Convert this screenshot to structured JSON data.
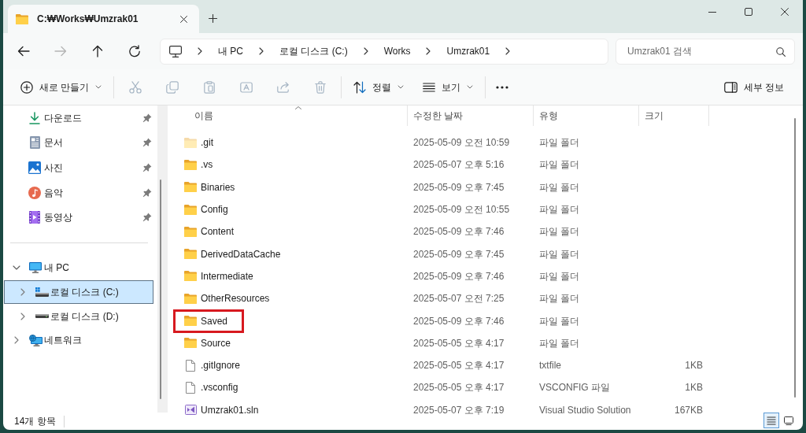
{
  "tab": {
    "title": "C:₩Works₩Umzrak01"
  },
  "nav_buttons": [
    {
      "kind": "back",
      "disabled": false
    },
    {
      "kind": "forward",
      "disabled": true
    },
    {
      "kind": "up",
      "disabled": false
    },
    {
      "kind": "refresh",
      "disabled": false
    }
  ],
  "address_bar": {
    "crumbs": [
      "내 PC",
      "로컬 디스크 (C:)",
      "Works",
      "Umzrak01"
    ]
  },
  "search": {
    "placeholder": "Umzrak01 검색"
  },
  "toolbar": {
    "groups": [
      [
        {
          "kind": "new",
          "label": "새로 만들기",
          "dropdown": true,
          "disabled": false
        }
      ],
      [
        {
          "kind": "cut",
          "disabled": true
        },
        {
          "kind": "copy",
          "disabled": true
        },
        {
          "kind": "paste",
          "disabled": true
        },
        {
          "kind": "rename",
          "disabled": true
        },
        {
          "kind": "share",
          "disabled": true
        },
        {
          "kind": "delete",
          "disabled": true
        }
      ],
      [
        {
          "kind": "sort",
          "label": "정렬",
          "dropdown": true,
          "disabled": false
        },
        {
          "kind": "view",
          "label": "보기",
          "dropdown": true,
          "disabled": false
        }
      ],
      [
        {
          "kind": "more",
          "disabled": false
        }
      ]
    ],
    "details_button": {
      "kind": "details",
      "label": "세부 정보",
      "dropdown": false,
      "disabled": false
    }
  },
  "sidebar": {
    "quick_access": [
      {
        "kind": "downloads",
        "label": "다운로드",
        "pinned": true
      },
      {
        "kind": "documents",
        "label": "문서",
        "pinned": true
      },
      {
        "kind": "pictures",
        "label": "사진",
        "pinned": true
      },
      {
        "kind": "music",
        "label": "음악",
        "pinned": true
      },
      {
        "kind": "videos",
        "label": "동영상",
        "pinned": true
      }
    ],
    "tree": [
      {
        "kind": "pc",
        "label": "내 PC",
        "expanded": true,
        "selected": false,
        "children": [
          {
            "kind": "windows-drive",
            "label": "로컬 디스크 (C:)",
            "expanded": false,
            "selected": true
          },
          {
            "kind": "drive",
            "label": "로컬 디스크 (D:)",
            "expanded": false,
            "selected": false
          }
        ]
      },
      {
        "kind": "network",
        "label": "네트워크",
        "expanded": false,
        "selected": false
      }
    ]
  },
  "file_list": {
    "columns": [
      {
        "label": "이름",
        "sorted": true
      },
      {
        "label": "수정한 날짜",
        "sorted": false
      },
      {
        "label": "유형",
        "sorted": false
      },
      {
        "label": "크기",
        "sorted": false
      }
    ],
    "rows": [
      {
        "kind": "folder",
        "name": ".git",
        "modified": "2025-05-09 오전 10:59",
        "type": "파일 폴더",
        "hidden": true,
        "highlighted": false
      },
      {
        "kind": "folder",
        "name": ".vs",
        "modified": "2025-05-07 오후 5:16",
        "type": "파일 폴더",
        "hidden": false,
        "highlighted": false
      },
      {
        "kind": "folder",
        "name": "Binaries",
        "modified": "2025-05-09 오후 7:45",
        "type": "파일 폴더",
        "hidden": false,
        "highlighted": false
      },
      {
        "kind": "folder",
        "name": "Config",
        "modified": "2025-05-09 오전 10:55",
        "type": "파일 폴더",
        "hidden": false,
        "highlighted": false
      },
      {
        "kind": "folder",
        "name": "Content",
        "modified": "2025-05-09 오후 7:46",
        "type": "파일 폴더",
        "hidden": false,
        "highlighted": false
      },
      {
        "kind": "folder",
        "name": "DerivedDataCache",
        "modified": "2025-05-09 오후 7:45",
        "type": "파일 폴더",
        "hidden": false,
        "highlighted": false
      },
      {
        "kind": "folder",
        "name": "Intermediate",
        "modified": "2025-05-09 오후 7:46",
        "type": "파일 폴더",
        "hidden": false,
        "highlighted": false
      },
      {
        "kind": "folder",
        "name": "OtherResources",
        "modified": "2025-05-07 오전 7:25",
        "type": "파일 폴더",
        "hidden": false,
        "highlighted": false
      },
      {
        "kind": "folder",
        "name": "Saved",
        "modified": "2025-05-09 오후 7:46",
        "type": "파일 폴더",
        "hidden": false,
        "highlighted": true
      },
      {
        "kind": "folder",
        "name": "Source",
        "modified": "2025-05-05 오후 4:17",
        "type": "파일 폴더",
        "hidden": false,
        "highlighted": false
      },
      {
        "kind": "file",
        "name": ".gitIgnore",
        "modified": "2025-05-05 오후 4:17",
        "type": "txtfile",
        "size": "1KB",
        "hidden": false,
        "highlighted": false
      },
      {
        "kind": "file",
        "name": ".vsconfig",
        "modified": "2025-05-05 오후 4:17",
        "type": "VSCONFIG 파일",
        "size": "1KB",
        "hidden": false,
        "highlighted": false
      },
      {
        "kind": "solution",
        "name": "Umzrak01.sln",
        "modified": "2025-05-07 오후 7:19",
        "type": "Visual Studio Solution",
        "size": "167KB",
        "hidden": false,
        "highlighted": false
      }
    ]
  },
  "status_bar": {
    "item_count": "14개 항목"
  },
  "view_modes": [
    {
      "kind": "details",
      "selected": true
    },
    {
      "kind": "tiles",
      "selected": false
    }
  ]
}
